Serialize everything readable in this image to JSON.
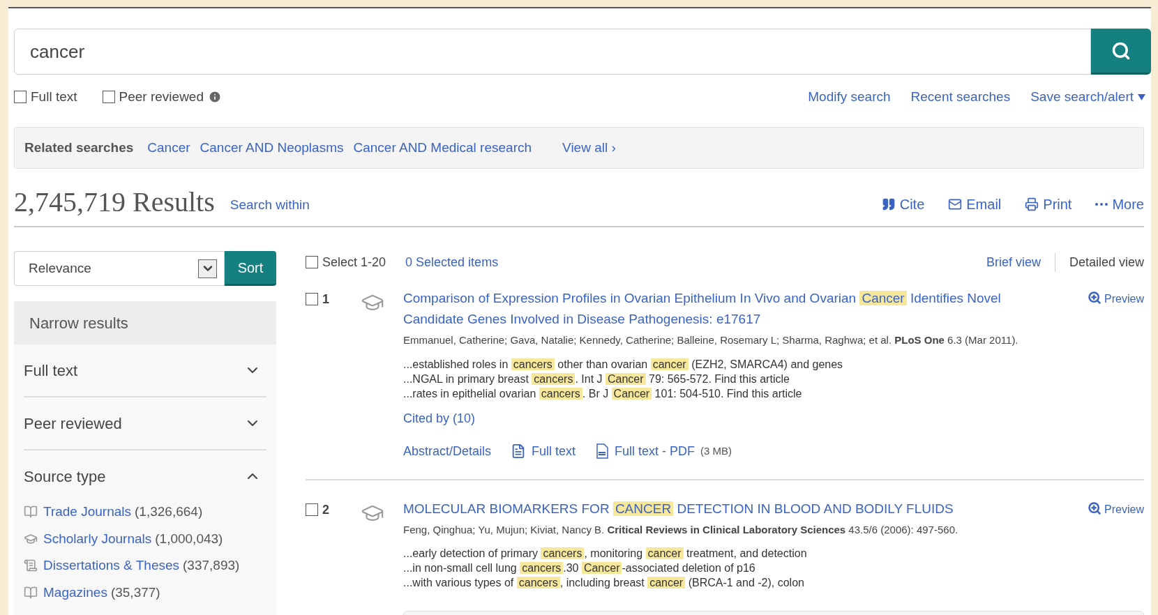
{
  "search": {
    "value": "cancer"
  },
  "filters": [
    {
      "label": "Full text",
      "checked": false,
      "info": false
    },
    {
      "label": "Peer reviewed",
      "checked": false,
      "info": true
    }
  ],
  "search_links": [
    "Modify search",
    "Recent searches"
  ],
  "save_alert": "Save search/alert",
  "related": {
    "label": "Related searches",
    "items": [
      "Cancer",
      "Cancer AND Neoplasms",
      "Cancer AND Medical research"
    ],
    "view_all": "View all ›"
  },
  "results": {
    "count": "2,745,719 Results",
    "search_within": "Search within"
  },
  "actions": [
    {
      "kind": "cite",
      "label": "Cite"
    },
    {
      "kind": "email",
      "label": "Email"
    },
    {
      "kind": "print",
      "label": "Print"
    },
    {
      "kind": "more",
      "label": "More"
    }
  ],
  "sort": {
    "value": "Relevance",
    "button": "Sort"
  },
  "select": {
    "label": "Select 1-20",
    "checked": false,
    "selected_items": "0 Selected items"
  },
  "views": [
    {
      "label": "Brief view",
      "selected": false
    },
    {
      "label": "Detailed view",
      "selected": true
    }
  ],
  "narrow": {
    "title": "Narrow results",
    "sections": [
      {
        "label": "Full text",
        "expanded": false
      },
      {
        "label": "Peer reviewed",
        "expanded": false
      },
      {
        "label": "Source type",
        "expanded": true,
        "items": [
          {
            "kind": "journal",
            "label": "Trade Journals",
            "count": "(1,326,664)"
          },
          {
            "kind": "scholarly",
            "label": "Scholarly Journals",
            "count": "(1,000,043)"
          },
          {
            "kind": "dissertation",
            "label": "Dissertations & Theses",
            "count": "(337,893)"
          },
          {
            "kind": "journal",
            "label": "Magazines",
            "count": "(35,377)"
          }
        ]
      }
    ]
  },
  "records": [
    {
      "number": "1",
      "checked": false,
      "preview": "Preview",
      "title": [
        {
          "text": "Comparison of Expression Profiles in Ovarian Epithelium In Vivo and Ovarian ",
          "highlight": false
        },
        {
          "text": "Cancer",
          "highlight": true
        },
        {
          "text": " Identifies Novel Candidate Genes Involved in Disease Pathogenesis: e17617",
          "highlight": false
        }
      ],
      "citation": "Emmanuel, Catherine; Gava, Natalie; Kennedy, Catherine; Balleine, Rosemary L; Sharma, Raghwa; et al. **PLoS One** 6.3  (Mar 2011).",
      "snippets": [
        [
          {
            "text": "...established roles in ",
            "highlight": false
          },
          {
            "text": "cancers",
            "highlight": true
          },
          {
            "text": " other than ovarian ",
            "highlight": false
          },
          {
            "text": "cancer",
            "highlight": true
          },
          {
            "text": " (EZH2, SMARCA4) and genes",
            "highlight": false
          }
        ],
        [
          {
            "text": "...NGAL in primary breast ",
            "highlight": false
          },
          {
            "text": "cancers",
            "highlight": true
          },
          {
            "text": ". Int J ",
            "highlight": false
          },
          {
            "text": "Cancer",
            "highlight": true
          },
          {
            "text": " 79: 565-572. Find this article",
            "highlight": false
          }
        ],
        [
          {
            "text": "...rates in epithelial ovarian ",
            "highlight": false
          },
          {
            "text": "cancers",
            "highlight": true
          },
          {
            "text": ". Br J ",
            "highlight": false
          },
          {
            "text": "Cancer",
            "highlight": true
          },
          {
            "text": " 101: 504-510. Find this article",
            "highlight": false
          }
        ]
      ],
      "cited_by": "Cited by (10)",
      "links": [
        {
          "kind": "abstract",
          "label": "Abstract/Details"
        },
        {
          "kind": "fulltext",
          "label": "Full text"
        },
        {
          "kind": "pdf",
          "label": "Full text - PDF",
          "size": "(3 MB)"
        }
      ]
    },
    {
      "number": "2",
      "checked": false,
      "preview": "Preview",
      "title": [
        {
          "text": "MOLECULAR BIOMARKERS FOR ",
          "highlight": false
        },
        {
          "text": "CANCER",
          "highlight": true
        },
        {
          "text": " DETECTION IN BLOOD AND BODILY FLUIDS",
          "highlight": false
        }
      ],
      "citation": "Feng, Qinghua; Yu, Mujun; Kiviat, Nancy B. **Critical Reviews in Clinical Laboratory Sciences** 43.5/6  (2006): 497-560.",
      "snippets": [
        [
          {
            "text": "...early detection of primary ",
            "highlight": false
          },
          {
            "text": "cancers",
            "highlight": true
          },
          {
            "text": ", monitoring ",
            "highlight": false
          },
          {
            "text": "cancer",
            "highlight": true
          },
          {
            "text": " treatment, and detection",
            "highlight": false
          }
        ],
        [
          {
            "text": "...in non-small cell lung ",
            "highlight": false
          },
          {
            "text": "cancers",
            "highlight": true
          },
          {
            "text": ".30 ",
            "highlight": false
          },
          {
            "text": "Cancer",
            "highlight": true
          },
          {
            "text": "-associated deletion of p16",
            "highlight": false
          }
        ],
        [
          {
            "text": "...with various types of ",
            "highlight": false
          },
          {
            "text": "cancers",
            "highlight": true
          },
          {
            "text": ", including breast ",
            "highlight": false
          },
          {
            "text": "cancer",
            "highlight": true
          },
          {
            "text": " (BRCA-1 and -2), colon",
            "highlight": false
          }
        ]
      ]
    }
  ]
}
